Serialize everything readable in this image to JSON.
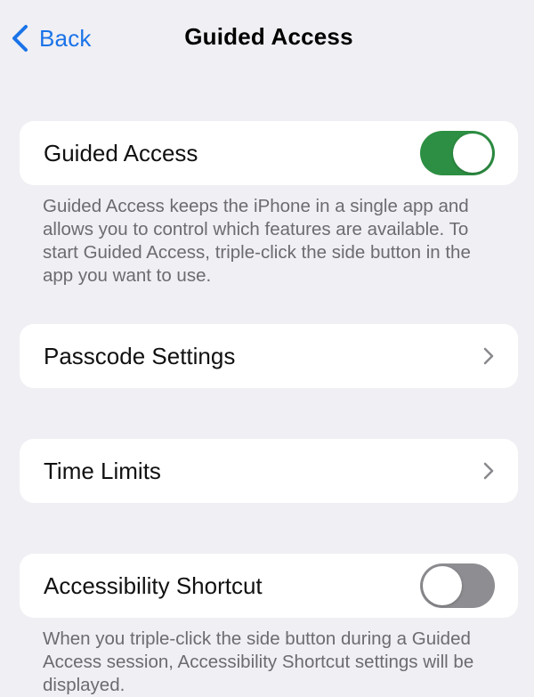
{
  "nav": {
    "back_label": "Back",
    "title": "Guided Access"
  },
  "guided_access": {
    "label": "Guided Access",
    "toggle_on": true,
    "footnote": "Guided Access keeps the iPhone in a single app and allows you to control which features are available. To start Guided Access, triple-click the side button in the app you want to use."
  },
  "passcode_settings": {
    "label": "Passcode Settings",
    "icon": "chevron-right-icon"
  },
  "time_limits": {
    "label": "Time Limits",
    "icon": "chevron-right-icon"
  },
  "accessibility_shortcut": {
    "label": "Accessibility Shortcut",
    "toggle_on": false,
    "footnote": "When you triple-click the side button during a Guided Access session, Accessibility Shortcut settings will be displayed."
  },
  "colors": {
    "accent": "#1a73e8",
    "toggle_on": "#2d8f43",
    "toggle_off": "#8e8e92",
    "background": "#efeff4"
  }
}
